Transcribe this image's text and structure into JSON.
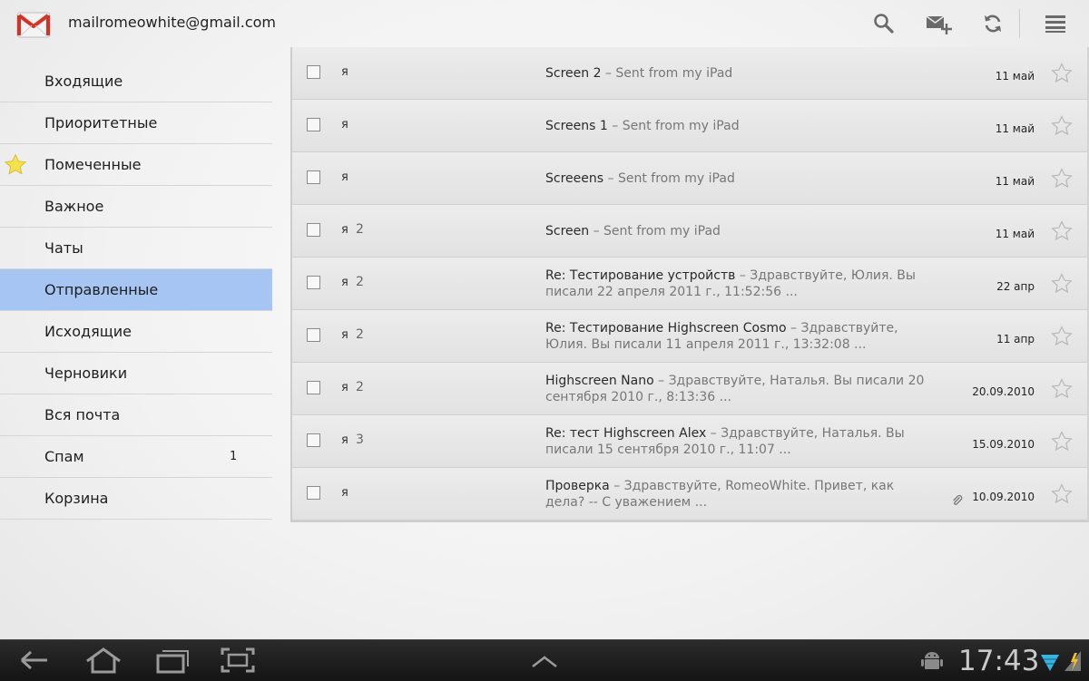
{
  "header": {
    "account": "mailromeowhite@gmail.com",
    "actions": [
      "search-icon",
      "compose-icon",
      "refresh-icon",
      "menu-icon"
    ]
  },
  "sidebar": {
    "items": [
      {
        "label": "Входящие",
        "count": "",
        "starred": false,
        "selected": false
      },
      {
        "label": "Приоритетные",
        "count": "",
        "starred": false,
        "selected": false
      },
      {
        "label": "Помеченные",
        "count": "",
        "starred": true,
        "selected": false
      },
      {
        "label": "Важное",
        "count": "",
        "starred": false,
        "selected": false
      },
      {
        "label": "Чаты",
        "count": "",
        "starred": false,
        "selected": false
      },
      {
        "label": "Отправленные",
        "count": "",
        "starred": false,
        "selected": true
      },
      {
        "label": "Исходящие",
        "count": "",
        "starred": false,
        "selected": false
      },
      {
        "label": "Черновики",
        "count": "",
        "starred": false,
        "selected": false
      },
      {
        "label": "Вся почта",
        "count": "",
        "starred": false,
        "selected": false
      },
      {
        "label": "Спам",
        "count": "1",
        "starred": false,
        "selected": false
      },
      {
        "label": "Корзина",
        "count": "",
        "starred": false,
        "selected": false
      }
    ]
  },
  "conversations": [
    {
      "sender": "я",
      "count": "",
      "subject": "Screen 2",
      "snippet": "Sent from my iPad",
      "date": "11 май",
      "attachment": false
    },
    {
      "sender": "я",
      "count": "",
      "subject": "Screens 1",
      "snippet": "Sent from my iPad",
      "date": "11 май",
      "attachment": false
    },
    {
      "sender": "я",
      "count": "",
      "subject": "Screeens",
      "snippet": "Sent from my iPad",
      "date": "11 май",
      "attachment": false
    },
    {
      "sender": "я",
      "count": "2",
      "subject": "Screen",
      "snippet": "Sent from my iPad",
      "date": "11 май",
      "attachment": false
    },
    {
      "sender": "я",
      "count": "2",
      "subject": "Re: Тестирование устройств",
      "snippet": "Здравствуйте, Юлия. Вы писали 22 апреля 2011 г., 11:52:56 ...",
      "date": "22 апр",
      "attachment": false
    },
    {
      "sender": "я",
      "count": "2",
      "subject": "Re: Тестирование Highscreen Cosmo",
      "snippet": "Здравствуйте, Юлия. Вы писали 11 апреля 2011 г., 13:32:08 ...",
      "date": "11 апр",
      "attachment": false
    },
    {
      "sender": "я",
      "count": "2",
      "subject": "Highscreen Nano",
      "snippet": "Здравствуйте, Наталья. Вы писали 20 сентября 2010 г., 8:13:36 ...",
      "date": "20.09.2010",
      "attachment": false
    },
    {
      "sender": "я",
      "count": "3",
      "subject": "Re: тест Highscreen Alex",
      "snippet": "Здравствуйте, Наталья. Вы писали 15 сентября 2010 г., 11:07 ...",
      "date": "15.09.2010",
      "attachment": false
    },
    {
      "sender": "я",
      "count": "",
      "subject": "Проверка",
      "snippet": "Здравствуйте, RomeoWhite. Привет, как дела? -- С уважением ...",
      "date": "10.09.2010",
      "attachment": true
    }
  ],
  "separator": " – ",
  "system_bar": {
    "clock": "17:43",
    "buttons": [
      "back-icon",
      "home-icon",
      "recent-apps-icon",
      "screenshot-icon",
      "up-chevron-icon"
    ]
  },
  "colors": {
    "selected_folder": "#a6c5f2",
    "star_yellow": "#f4e24a",
    "gmail_red": "#d93025",
    "wifi_blue": "#33b5e5"
  }
}
